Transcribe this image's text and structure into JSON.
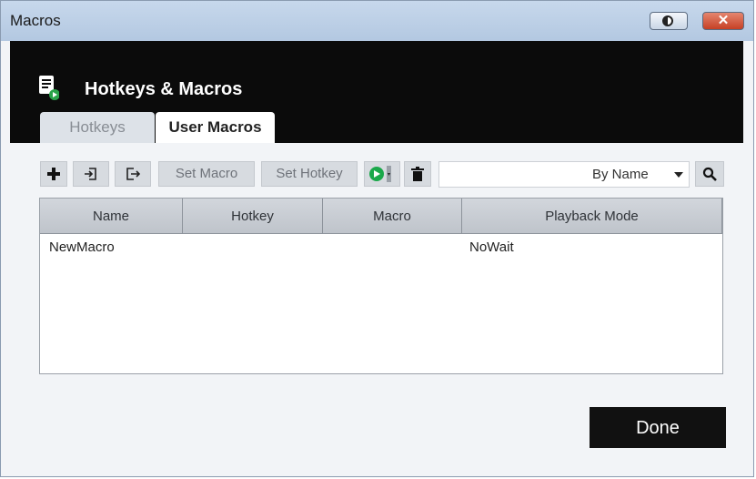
{
  "window": {
    "title": "Macros"
  },
  "header": {
    "title": "Hotkeys & Macros"
  },
  "tabs": [
    {
      "label": "Hotkeys",
      "active": false
    },
    {
      "label": "User Macros",
      "active": true
    }
  ],
  "toolbar": {
    "add_icon": "plus-icon",
    "import_icon": "import-icon",
    "export_icon": "export-icon",
    "set_macro_label": "Set Macro",
    "set_hotkey_label": "Set Hotkey",
    "play_icon": "play-icon",
    "delete_icon": "trash-icon",
    "search_value": "",
    "sort_value": "By Name",
    "search_icon": "magnifier-icon"
  },
  "grid": {
    "columns": [
      "Name",
      "Hotkey",
      "Macro",
      "Playback Mode"
    ],
    "rows": [
      {
        "name": "NewMacro",
        "hotkey": "",
        "macro": "",
        "playback": "NoWait"
      }
    ]
  },
  "footer": {
    "done_label": "Done"
  },
  "colors": {
    "header_bg": "#0b0b0b",
    "play_green": "#1aa84a",
    "close_red": "#c64025"
  }
}
